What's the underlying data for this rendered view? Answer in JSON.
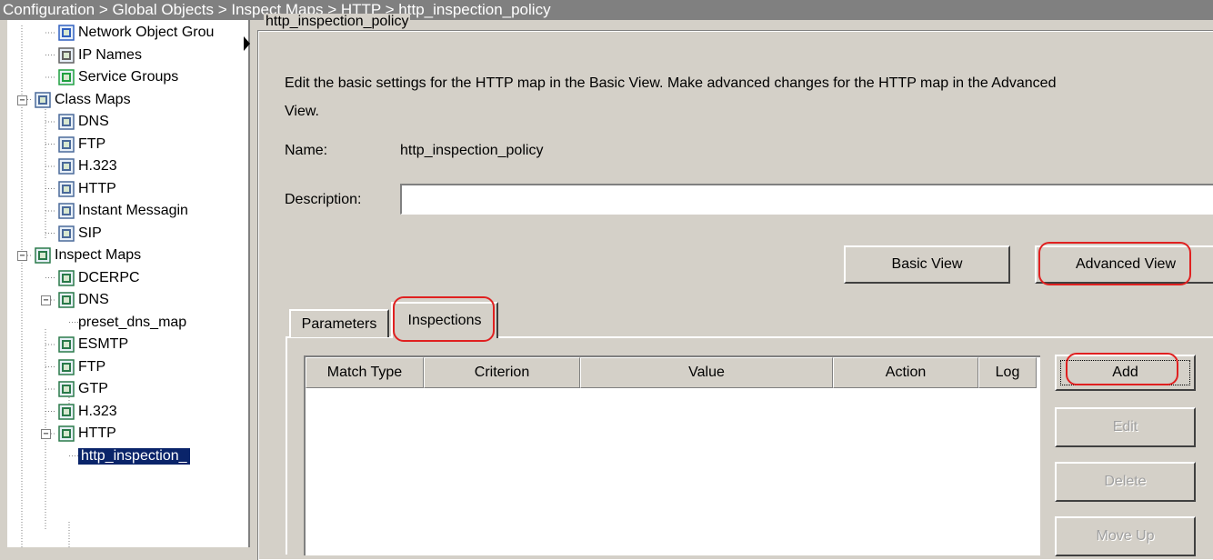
{
  "breadcrumb": "Configuration > Global Objects > Inspect Maps > HTTP > http_inspection_policy",
  "tree": {
    "items": [
      {
        "label": "Network Object Grou",
        "icon": "network-object-group-icon"
      },
      {
        "label": "IP Names",
        "icon": "ip-names-icon"
      },
      {
        "label": "Service Groups",
        "icon": "service-groups-icon"
      },
      {
        "label": "Class Maps",
        "icon": "class-map-icon",
        "expander": "−"
      },
      {
        "label": "DNS",
        "icon": "class-map-icon"
      },
      {
        "label": "FTP",
        "icon": "class-map-icon"
      },
      {
        "label": "H.323",
        "icon": "class-map-icon"
      },
      {
        "label": "HTTP",
        "icon": "class-map-icon"
      },
      {
        "label": "Instant Messagin",
        "icon": "class-map-icon"
      },
      {
        "label": "SIP",
        "icon": "class-map-icon"
      },
      {
        "label": "Inspect Maps",
        "icon": "inspect-map-icon",
        "expander": "−"
      },
      {
        "label": "DCERPC",
        "icon": "inspect-map-icon"
      },
      {
        "label": "DNS",
        "icon": "inspect-map-icon",
        "expander": "−"
      },
      {
        "label": "preset_dns_map",
        "icon": ""
      },
      {
        "label": "ESMTP",
        "icon": "inspect-map-icon"
      },
      {
        "label": "FTP",
        "icon": "inspect-map-icon"
      },
      {
        "label": "GTP",
        "icon": "inspect-map-icon"
      },
      {
        "label": "H.323",
        "icon": "inspect-map-icon"
      },
      {
        "label": "HTTP",
        "icon": "inspect-map-icon",
        "expander": "−"
      },
      {
        "label": "http_inspection_",
        "icon": "",
        "selected": true
      }
    ]
  },
  "panel": {
    "group_title": "http_inspection_policy",
    "intro_line1": "Edit the basic settings for the HTTP map in the Basic View. Make advanced changes for the HTTP map in the Advanced",
    "intro_line2": "View.",
    "name_label": "Name:",
    "name_value": "http_inspection_policy",
    "description_label": "Description:",
    "description_value": "",
    "basic_view_label": "Basic View",
    "advanced_view_label": "Advanced View"
  },
  "tabs": [
    {
      "label": "Parameters",
      "active": false
    },
    {
      "label": "Inspections",
      "active": true
    }
  ],
  "table": {
    "columns": [
      "Match Type",
      "Criterion",
      "Value",
      "Action",
      "Log"
    ],
    "rows": []
  },
  "actions": {
    "add_label": "Add",
    "edit_label": "Edit",
    "delete_label": "Delete",
    "move_up_label": "Move Up"
  },
  "colors": {
    "highlight": "#e02020",
    "selection": "#0a246a",
    "titlebar": "#808080",
    "window": "#d4d0c8"
  }
}
